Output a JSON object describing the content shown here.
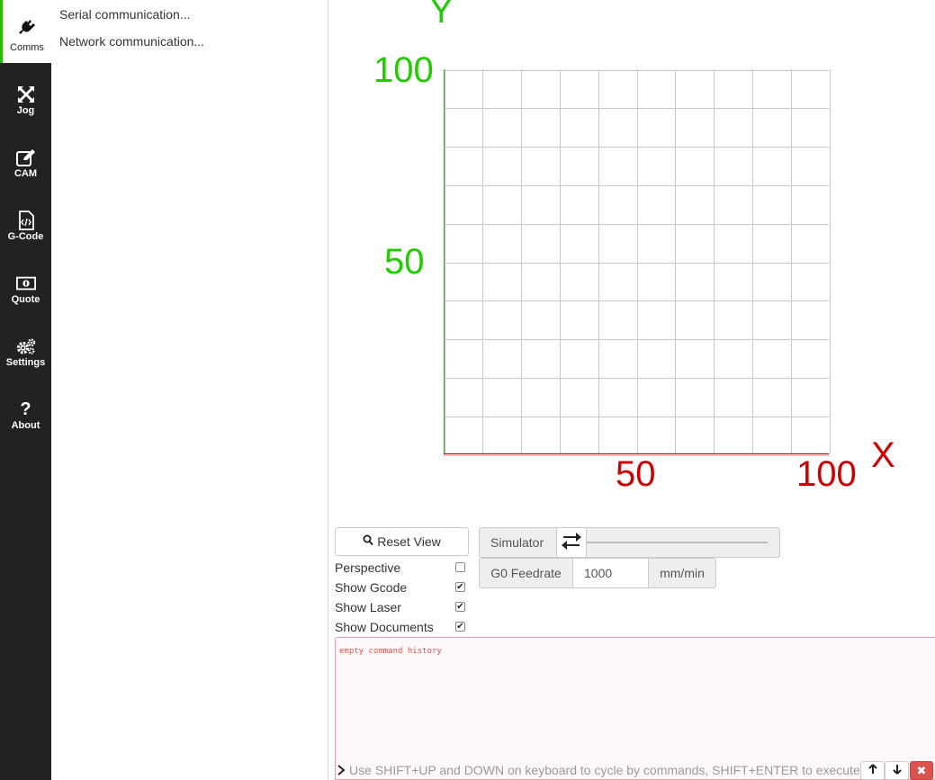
{
  "sidebar": {
    "items": [
      {
        "label": "Comms",
        "icon": "plug-icon"
      },
      {
        "label": "Jog",
        "icon": "arrows-icon"
      },
      {
        "label": "CAM",
        "icon": "edit-icon"
      },
      {
        "label": "G-Code",
        "icon": "file-code-icon"
      },
      {
        "label": "Quote",
        "icon": "money-icon"
      },
      {
        "label": "Settings",
        "icon": "gears-icon"
      },
      {
        "label": "About",
        "icon": "question-icon"
      }
    ]
  },
  "panel": {
    "links": [
      "Serial communication...",
      "Network communication..."
    ]
  },
  "viewport": {
    "y_axis_label": "Y",
    "x_axis_label": "X",
    "y_ticks": [
      "100",
      "50"
    ],
    "x_ticks": [
      "50",
      "100"
    ],
    "colors": {
      "x_axis": "#cc0000",
      "y_axis": "#22cc00",
      "grid": "#c8c8c8"
    }
  },
  "controls": {
    "reset_view": "Reset View",
    "simulator_label": "Simulator",
    "g0_label": "G0 Feedrate",
    "g0_value": "1000",
    "g0_unit": "mm/min",
    "checks": [
      {
        "label": "Perspective",
        "checked": false
      },
      {
        "label": "Show Gcode",
        "checked": true
      },
      {
        "label": "Show Laser",
        "checked": true
      },
      {
        "label": "Show Documents",
        "checked": true
      }
    ]
  },
  "console": {
    "empty_history": "empty command history",
    "placeholder": "Use SHIFT+UP and DOWN on keyboard to cycle by commands, SHIFT+ENTER to execute"
  }
}
